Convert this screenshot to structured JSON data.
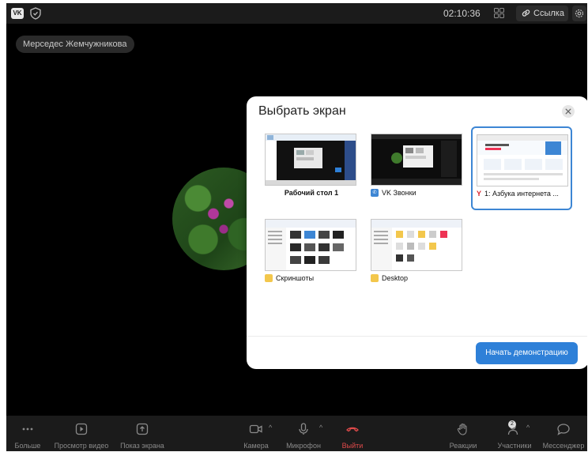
{
  "header": {
    "time": "02:10:36",
    "link_label": "Ссылка"
  },
  "participant": {
    "name": "Мерседес Жемчужникова"
  },
  "dialog": {
    "title": "Выбрать экран",
    "start_button": "Начать демонстрацию",
    "sources": [
      {
        "label": "Рабочий стол 1",
        "icon": "none",
        "selected": false
      },
      {
        "label": "VK Звонки",
        "icon": "vk-calls-icon",
        "selected": false
      },
      {
        "label": "1: Азбука интернета ...",
        "icon": "yandex-browser-icon",
        "selected": true
      },
      {
        "label": "Скриншоты",
        "icon": "folder-icon",
        "selected": false
      },
      {
        "label": "Desktop",
        "icon": "folder-icon",
        "selected": false
      }
    ]
  },
  "toolbar": {
    "more": "Больше",
    "watch_video": "Просмотр видео",
    "share_screen": "Показ экрана",
    "camera": "Камера",
    "microphone": "Микрофон",
    "leave": "Выйти",
    "reactions": "Реакции",
    "participants": "Участники",
    "participants_count": "2",
    "messenger": "Мессенджер"
  },
  "colors": {
    "accent": "#2e80d8",
    "selected_border": "#3d86d4",
    "leave": "#e04a4a",
    "background": "#000000"
  }
}
